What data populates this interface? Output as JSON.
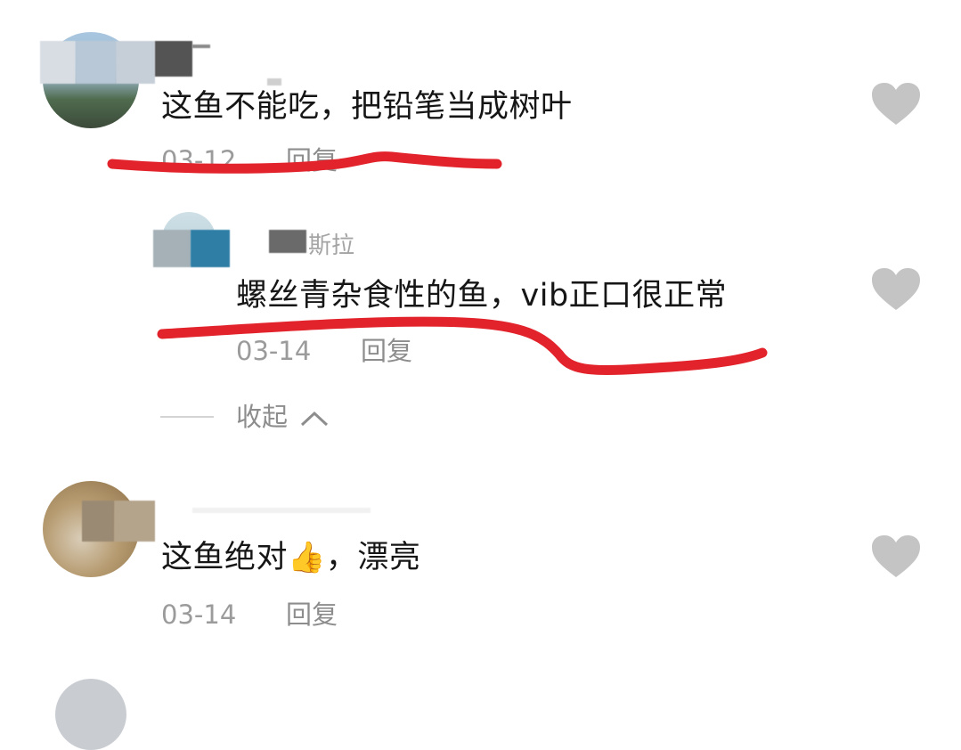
{
  "comments": [
    {
      "text": "这鱼不能吃，把铅笔当成树叶",
      "date": "03-12",
      "reply_label": "回复",
      "username_partial": "",
      "replies": [
        {
          "text": "螺丝青杂食性的鱼，vib正口很正常",
          "date": "03-14",
          "reply_label": "回复",
          "username_partial": "斯拉"
        }
      ],
      "collapse_label": "收起"
    },
    {
      "text": "这鱼绝对",
      "emoji": "👍",
      "text_after": "，漂亮",
      "date": "03-14",
      "reply_label": "回复"
    }
  ],
  "icons": {
    "like": "heart-icon",
    "collapse": "chevron-up-icon"
  },
  "colors": {
    "annotation_red": "#e2232b",
    "meta_gray": "#9b9b9b",
    "heart_gray": "#c4c4c4"
  }
}
